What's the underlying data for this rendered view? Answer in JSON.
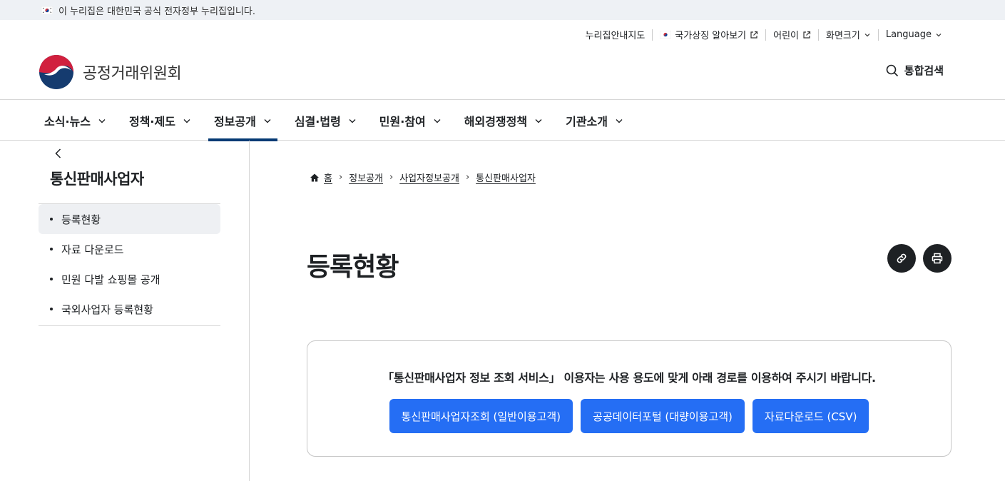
{
  "gov_banner": {
    "text": "이 누리집은 대한민국 공식 전자정부 누리집입니다."
  },
  "utility": {
    "items": [
      {
        "label": "누리집안내지도"
      },
      {
        "label": "국가상징 알아보기"
      },
      {
        "label": "어린이"
      },
      {
        "label": "화면크기"
      },
      {
        "label": "Language"
      }
    ]
  },
  "header": {
    "site_name": "공정거래위원회",
    "search_label": "통합검색"
  },
  "gnb": {
    "items": [
      {
        "label": "소식·뉴스"
      },
      {
        "label": "정책·제도"
      },
      {
        "label": "정보공개"
      },
      {
        "label": "심결·법령"
      },
      {
        "label": "민원·참여"
      },
      {
        "label": "해외경쟁정책"
      },
      {
        "label": "기관소개"
      }
    ]
  },
  "sidebar": {
    "title": "통신판매사업자",
    "items": [
      {
        "label": "등록현황"
      },
      {
        "label": "자료 다운로드"
      },
      {
        "label": "민원 다발 쇼핑몰 공개"
      },
      {
        "label": "국외사업자 등록현황"
      }
    ]
  },
  "breadcrumb": {
    "items": [
      {
        "label": "홈"
      },
      {
        "label": "정보공개"
      },
      {
        "label": "사업자정보공개"
      },
      {
        "label": "통신판매사업자"
      }
    ]
  },
  "main": {
    "title": "등록현황",
    "notice": "「통신판매사업자 정보 조회 서비스」 이용자는 사용 용도에 맞게 아래 경로를 이용하여 주시기 바랍니다.",
    "buttons": [
      {
        "label": "통신판매사업자조회 (일반이용고객)"
      },
      {
        "label": "공공데이터포털 (대량이용고객)"
      },
      {
        "label": "자료다운로드 (CSV)"
      }
    ]
  },
  "colors": {
    "accent": "#256ef4",
    "gnb_active": "#063a74",
    "banner_bg": "#eef1f5"
  },
  "icons": [
    "flag-icon",
    "external-link-icon",
    "chevron-down-icon",
    "search-icon",
    "chevron-left-icon",
    "home-icon",
    "link-icon",
    "print-icon"
  ]
}
